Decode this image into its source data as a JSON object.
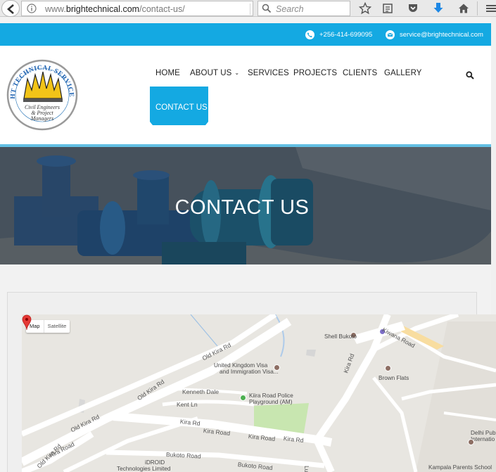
{
  "browser": {
    "url_prefix": "www.",
    "url_domain": "brightechnical.com",
    "url_path": "/contact-us/",
    "search_placeholder": "Search"
  },
  "topbar": {
    "phone": "+256-414-699095",
    "email": "service@brightechnical.com",
    "background": "#14a9e2"
  },
  "logo": {
    "company_arc_text": "BRIGHT TECHNICAL SERVICES LTD",
    "tagline_line1": "Civil Engineers",
    "tagline_line2": "& Project",
    "tagline_line3": "Managers"
  },
  "nav": {
    "home": "HOME",
    "about": "ABOUT US",
    "services": "SERVICES",
    "projects": "PROJECTS",
    "clients": "CLIENTS",
    "gallery": "GALLERY",
    "contact": "CONTACT US"
  },
  "hero": {
    "title": "CONTACT US"
  },
  "map": {
    "type_map": "Map",
    "type_satellite": "Satellite",
    "labels": {
      "shell": "Shell Bukoto",
      "kiwana": "Kiwana Road",
      "uk_visa_1": "United Kingdom Visa",
      "uk_visa_2": "and Immigration Visa...",
      "brown_flats": "Brown Flats",
      "kenneth_dale": "Kenneth Dale",
      "kent_ln": "Kent Ln",
      "police_1": "Kiira Road Police",
      "police_2": "Playground (AM)",
      "delhi_1": "Delhi Publ",
      "delhi_2": "Internatio",
      "kampala_parents": "Kampala Parents School",
      "idroid_1": "iDROID",
      "idroid_2": "Technologies Limited"
    },
    "roads": {
      "old_kira_1": "Old Kira Rd",
      "old_kira_2": "Old Kira Rd",
      "old_kira_3": "Old Kira Rd",
      "old_kira_4": "Old Kira Rd",
      "kira_rd_1": "Kira Rd",
      "kira_road_1": "Kira Road",
      "kira_road_2": "Kira Road",
      "kira_rd_2": "Kira Rd",
      "kira_road_3": "Kira Road",
      "kira_rd_vert": "Kira Rd",
      "bukoto_1": "Bukoto Road",
      "bukoto_2": "Bukoto Road",
      "lugogo": "Lugo"
    }
  }
}
